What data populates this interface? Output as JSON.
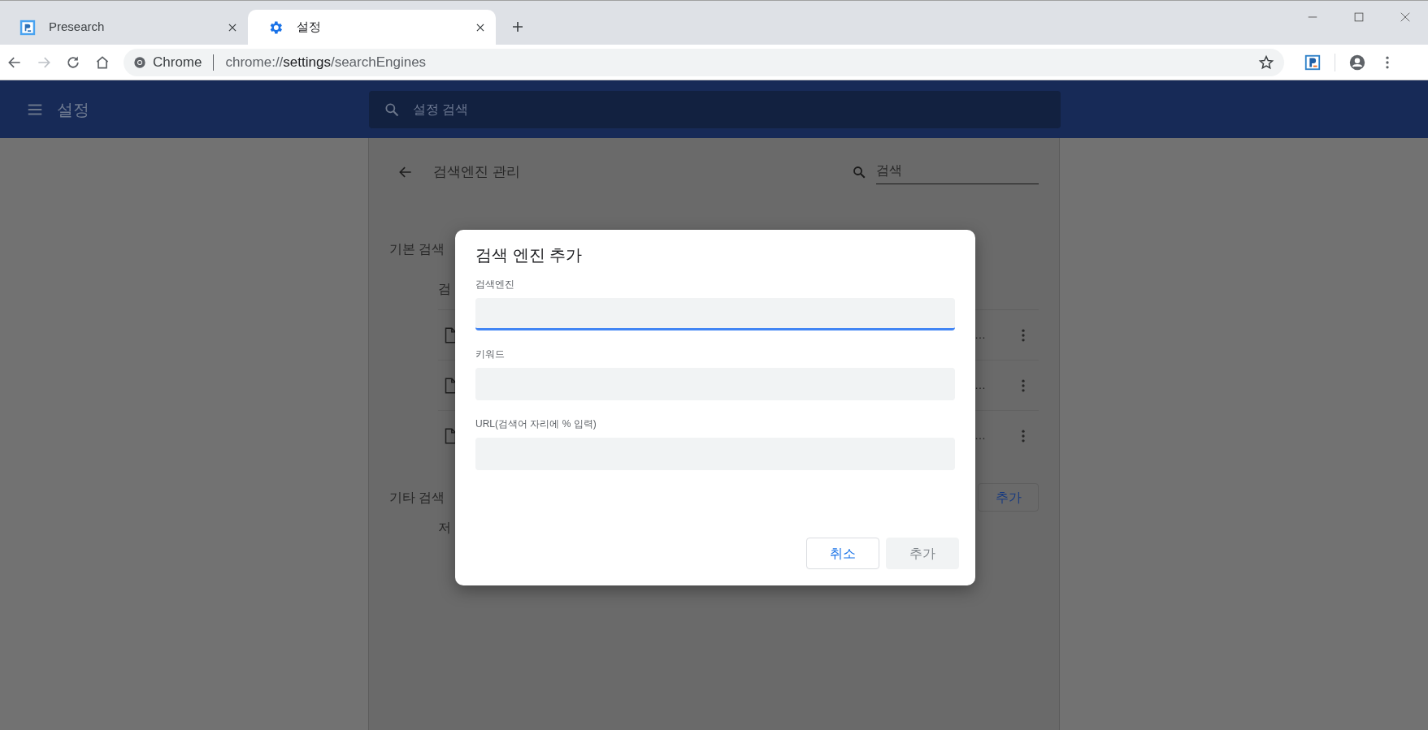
{
  "browser": {
    "tabs": [
      {
        "title": "Presearch",
        "selected": false
      },
      {
        "title": "설정",
        "selected": true
      }
    ],
    "address": {
      "scheme_label": "Chrome",
      "url_prefix": "chrome://",
      "url_host": "settings",
      "url_path": "/searchEngines"
    }
  },
  "header": {
    "title": "설정",
    "search_placeholder": "설정 검색"
  },
  "page": {
    "title": "검색엔진 관리",
    "search_placeholder": "검색",
    "default_section": "기본 검색",
    "column_1": "검",
    "rows": [
      {
        "column_2": "…"
      },
      {
        "column_2": "…"
      },
      {
        "column_2": "…"
      }
    ],
    "other_section": "기타 검색",
    "add_button": "추가",
    "saved_label": "저"
  },
  "dialog": {
    "title": "검색 엔진 추가",
    "fields": [
      {
        "label": "검색엔진",
        "focused": true
      },
      {
        "label": "키워드",
        "focused": false
      },
      {
        "label": "URL(검색어 자리에 % 입력)",
        "focused": false
      }
    ],
    "buttons": [
      {
        "label": "취소",
        "disabled": false
      },
      {
        "label": "추가",
        "disabled": true
      }
    ]
  }
}
